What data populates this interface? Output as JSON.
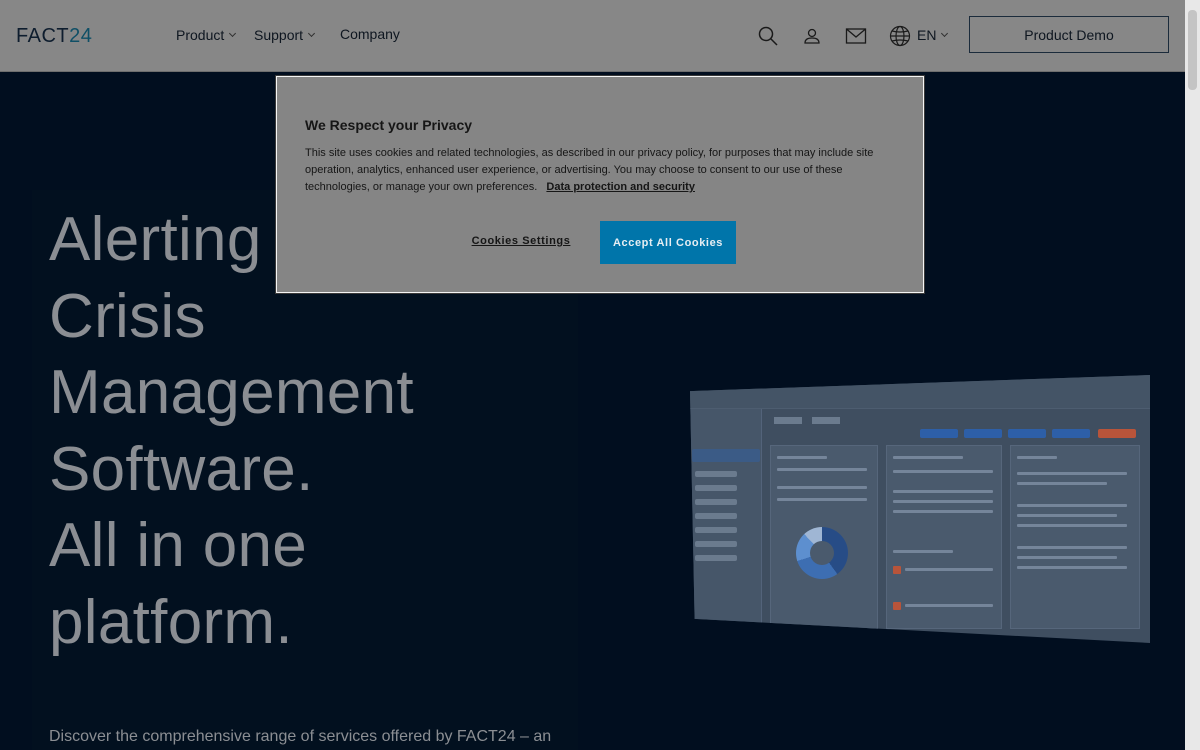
{
  "header": {
    "logo_text": "FACT",
    "logo_num": "24",
    "nav": [
      {
        "label": "Product"
      },
      {
        "label": "Support"
      },
      {
        "label": "Company"
      }
    ],
    "language": "EN",
    "demo_button": "Product Demo",
    "icons": [
      "search-icon",
      "user-icon",
      "mail-icon",
      "globe-icon"
    ]
  },
  "hero": {
    "title_lines": [
      "Alerting",
      "Crisis",
      "Management",
      "Software.",
      "All in one",
      "platform."
    ],
    "description": "Discover the comprehensive range of services offered by FACT24 – an"
  },
  "cookie_modal": {
    "title": "We Respect your Privacy",
    "text": "This site uses cookies and related technologies, as described in our privacy policy, for purposes that may include site operation, analytics, enhanced user experience, or advertising. You may choose to consent to our use of these technologies, or manage your own preferences.",
    "link": "Data protection and security",
    "settings_button": "Cookies Settings",
    "accept_button": "Accept All Cookies"
  },
  "colors": {
    "background": "#010e1f",
    "header_bg": "#878787",
    "accept_button": "#0075aa",
    "modal_bg": "#858585"
  }
}
